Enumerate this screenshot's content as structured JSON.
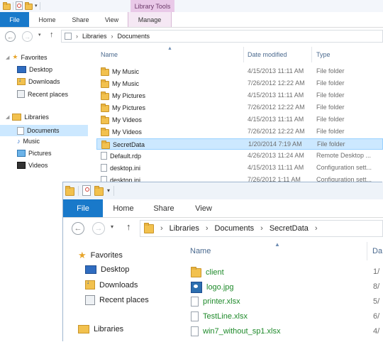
{
  "back": {
    "ribbon": {
      "file": "File",
      "home": "Home",
      "share": "Share",
      "view": "View",
      "context_group": "Library Tools",
      "manage": "Manage"
    },
    "address": {
      "crumbs": [
        "Libraries",
        "Documents"
      ]
    },
    "columns": {
      "name": "Name",
      "date": "Date modified",
      "type": "Type"
    },
    "nav": {
      "favorites": "Favorites",
      "fav_items": [
        "Desktop",
        "Downloads",
        "Recent places"
      ],
      "libraries": "Libraries",
      "lib_items": [
        "Documents",
        "Music",
        "Pictures",
        "Videos"
      ]
    },
    "files": [
      {
        "name": "My Music",
        "date": "4/15/2013 11:11 AM",
        "type": "File folder",
        "icon": "music-folder-icon"
      },
      {
        "name": "My Music",
        "date": "7/26/2012 12:22 AM",
        "type": "File folder",
        "icon": "music-folder-icon"
      },
      {
        "name": "My Pictures",
        "date": "4/15/2013 11:11 AM",
        "type": "File folder",
        "icon": "pictures-folder-icon"
      },
      {
        "name": "My Pictures",
        "date": "7/26/2012 12:22 AM",
        "type": "File folder",
        "icon": "pictures-folder-icon"
      },
      {
        "name": "My Videos",
        "date": "4/15/2013 11:11 AM",
        "type": "File folder",
        "icon": "videos-folder-icon"
      },
      {
        "name": "My Videos",
        "date": "7/26/2012 12:22 AM",
        "type": "File folder",
        "icon": "videos-folder-icon"
      },
      {
        "name": "SecretData",
        "date": "1/20/2014 7:19 AM",
        "type": "File folder",
        "icon": "folder-icon"
      },
      {
        "name": "Default.rdp",
        "date": "4/26/2013 11:24 AM",
        "type": "Remote Desktop ...",
        "icon": "rdp-file-icon"
      },
      {
        "name": "desktop.ini",
        "date": "4/15/2013 11:11 AM",
        "type": "Configuration sett...",
        "icon": "ini-file-icon"
      },
      {
        "name": "desktop.ini",
        "date": "7/26/2012 1:11 AM",
        "type": "Configuration sett...",
        "icon": "ini-file-icon"
      }
    ]
  },
  "front": {
    "ribbon": {
      "file": "File",
      "home": "Home",
      "share": "Share",
      "view": "View"
    },
    "address": {
      "crumbs": [
        "Libraries",
        "Documents",
        "SecretData"
      ]
    },
    "columns": {
      "name": "Name",
      "date": "Da"
    },
    "nav": {
      "favorites": "Favorites",
      "fav_items": [
        "Desktop",
        "Downloads",
        "Recent places"
      ],
      "libraries": "Libraries"
    },
    "files": [
      {
        "name": "client",
        "date": "1/",
        "icon": "folder-icon"
      },
      {
        "name": "logo.jpg",
        "date": "8/",
        "icon": "image-file-icon"
      },
      {
        "name": "printer.xlsx",
        "date": "5/",
        "icon": "xlsx-file-icon"
      },
      {
        "name": "TestLine.xlsx",
        "date": "6/",
        "icon": "xlsx-file-icon"
      },
      {
        "name": "win7_without_sp1.xlsx",
        "date": "4/",
        "icon": "xlsx-file-icon"
      }
    ]
  },
  "colors": {
    "accent": "#1979ca",
    "selection": "#cce8ff",
    "context_tab": "#e9c9e8",
    "compressed_name": "#1e8a2a"
  }
}
